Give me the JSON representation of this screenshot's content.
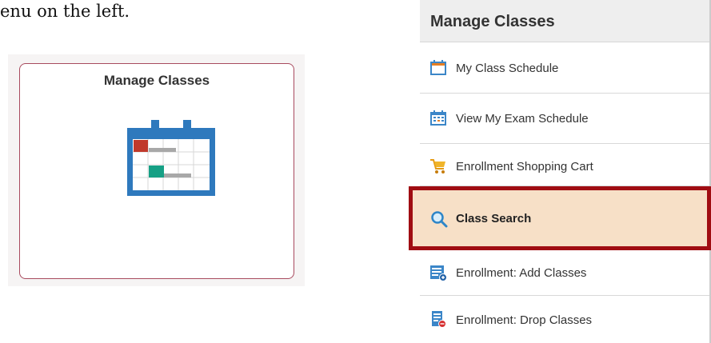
{
  "document": {
    "fragment": "enu on the left."
  },
  "tile": {
    "title": "Manage Classes",
    "icon": "calendar-icon"
  },
  "menu": {
    "title": "Manage Classes",
    "items": [
      {
        "label": "My Class Schedule",
        "icon": "calendar-icon",
        "active": false
      },
      {
        "label": "View My Exam Schedule",
        "icon": "exam-calendar-icon",
        "active": false
      },
      {
        "label": "Enrollment Shopping Cart",
        "icon": "shopping-cart-icon",
        "active": false
      },
      {
        "label": "Class Search",
        "icon": "search-icon",
        "active": true
      },
      {
        "label": "Enrollment:  Add Classes",
        "icon": "add-list-icon",
        "active": false
      },
      {
        "label": "Enrollment:  Drop Classes",
        "icon": "drop-list-icon",
        "active": false
      }
    ]
  },
  "colors": {
    "highlight_border": "#a00d12",
    "highlight_fill": "#f7e0c7",
    "calendar_blue": "#2e79bd",
    "accent_red": "#c0392b",
    "accent_green": "#16a085"
  }
}
